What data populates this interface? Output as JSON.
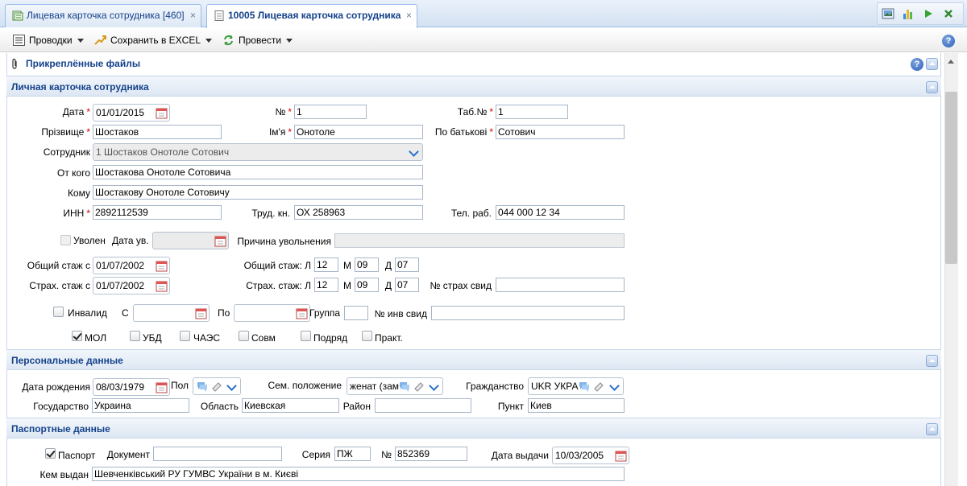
{
  "tabs": [
    {
      "label": "Лицевая карточка сотрудника [460]",
      "close": "×"
    },
    {
      "label": "10005 Лицевая карточка сотрудника",
      "close": "×"
    }
  ],
  "toolbar": {
    "postings": "Проводки",
    "save_excel": "Сохранить в EXCEL",
    "post": "Провести"
  },
  "attached_files": {
    "title": "Прикреплённые файлы"
  },
  "sections": {
    "personal_card": "Личная карточка сотрудника",
    "personal_data": "Персональные данные",
    "passport_data": "Паспортные данные"
  },
  "card": {
    "date_label": "Дата",
    "date_value": "01/01/2015",
    "number_label": "№",
    "number_value": "1",
    "tabno_label": "Таб.№",
    "tabno_value": "1",
    "surname_label": "Прізвище",
    "surname_value": "Шостаков",
    "name_label": "Ім'я",
    "name_value": "Онотоле",
    "patronymic_label": "По батькові",
    "patronymic_value": "Сотович",
    "employee_label": "Сотрудник",
    "employee_value": "1 Шостаков Онотоле Сотович",
    "from_label": "От кого",
    "from_value": "Шостакова Онотоле Сотовича",
    "to_label": "Кому",
    "to_value": "Шостакову Онотоле Сотовичу",
    "inn_label": "ИНН",
    "inn_value": "2892112539",
    "workbook_label": "Труд. кн.",
    "workbook_value": "ОХ 258963",
    "phone_label": "Тел. раб.",
    "phone_value": "044 000 12 34",
    "fired_label": "Уволен",
    "fired_date_label": "Дата ув.",
    "reason_label": "Причина увольнения",
    "total_exp_from_label": "Общий стаж с",
    "total_exp_from_value": "01/07/2002",
    "total_exp_label": "Общий стаж: Л",
    "total_exp_y": "12",
    "m_label": "М",
    "total_exp_m": "09",
    "d_label": "Д",
    "total_exp_d": "07",
    "ins_exp_from_label": "Страх. стаж с",
    "ins_exp_from_value": "01/07/2002",
    "ins_exp_label": "Страх. стаж: Л",
    "ins_exp_y": "12",
    "ins_exp_m": "09",
    "ins_exp_d": "07",
    "ins_cert_label": "№ страх свид",
    "invalid_label": "Инвалид",
    "from_date_label": "С",
    "to_date_label": "По",
    "group_label": "Группа",
    "inv_cert_label": "№ инв свид",
    "mol_label": "МОЛ",
    "ubd_label": "УБД",
    "chaes_label": "ЧАЭС",
    "sovm_label": "Совм",
    "podryad_label": "Подряд",
    "prakt_label": "Практ."
  },
  "personal": {
    "birth_label": "Дата рождения",
    "birth_value": "08/03/1979",
    "sex_label": "Пол",
    "marital_label": "Сем. положение",
    "marital_value": "женат (зам",
    "citizenship_label": "Гражданство",
    "citizenship_value": "UKR УКРА",
    "state_label": "Государство",
    "state_value": "Украина",
    "region_label": "Область",
    "region_value": "Киевская",
    "district_label": "Район",
    "place_label": "Пункт",
    "place_value": "Киев"
  },
  "passport": {
    "passport_label": "Паспорт",
    "document_label": "Документ",
    "series_label": "Серия",
    "series_value": "ПЖ",
    "number_label": "№",
    "number_value": "852369",
    "issue_date_label": "Дата выдачи",
    "issue_date_value": "10/03/2005",
    "issued_by_label": "Кем выдан",
    "issued_by_value": "Шевченківський РУ ГУМВС України в м. Києві"
  },
  "colors": {
    "accent": "#15428b",
    "required": "#d00000"
  }
}
